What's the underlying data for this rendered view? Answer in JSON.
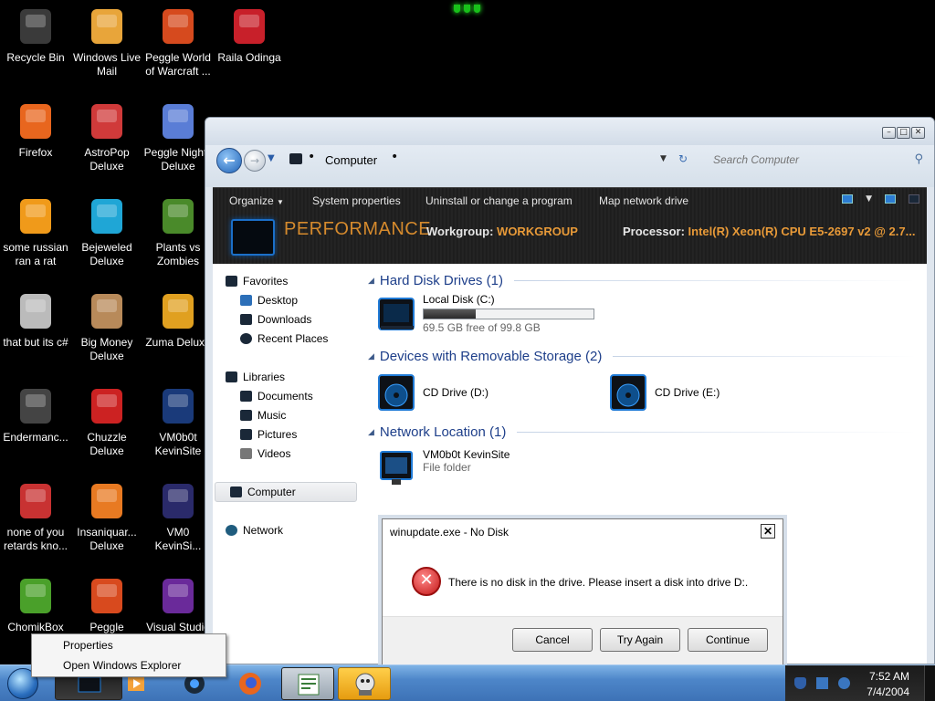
{
  "desktop": {
    "icons": [
      {
        "label": "Recycle Bin",
        "icon": "recycle-bin-icon"
      },
      {
        "label": "Windows Live Mail",
        "icon": "mail-icon"
      },
      {
        "label": "Peggle World of Warcraft ...",
        "icon": "peggle-icon"
      },
      {
        "label": "Raila Odinga",
        "icon": "image-file-icon"
      },
      {
        "label": "Firefox",
        "icon": "firefox-icon"
      },
      {
        "label": "AstroPop Deluxe",
        "icon": "astropop-icon"
      },
      {
        "label": "Peggle Nights Deluxe",
        "icon": "peggle-nights-icon"
      },
      {
        "label": "some russian ran a rat",
        "icon": "java-icon"
      },
      {
        "label": "Bejeweled Deluxe",
        "icon": "bejeweled-icon"
      },
      {
        "label": "Plants vs Zombies",
        "icon": "plants-vs-zombies-icon"
      },
      {
        "label": "that but its c#",
        "icon": "shortcut-icon"
      },
      {
        "label": "Big Money Deluxe",
        "icon": "big-money-icon"
      },
      {
        "label": "Zuma Deluxe",
        "icon": "zuma-icon"
      },
      {
        "label": "Endermanc...",
        "icon": "program-icon"
      },
      {
        "label": "Chuzzle Deluxe",
        "icon": "chuzzle-icon"
      },
      {
        "label": "VM0b0t KevinSite",
        "icon": "folder-monitor-icon"
      },
      {
        "label": "none of you retards kno...",
        "icon": "chrome-icon"
      },
      {
        "label": "Insaniquar... Deluxe",
        "icon": "insaniquarium-icon"
      },
      {
        "label": "VM0 KevinSi...",
        "icon": "file-icon"
      },
      {
        "label": "ChomikBox",
        "icon": "chomikbox-icon"
      },
      {
        "label": "Peggle Deluxe",
        "icon": "peggle-deluxe-icon"
      },
      {
        "label": "Visual Studio",
        "icon": "visual-studio-icon"
      }
    ]
  },
  "explorer": {
    "breadcrumb": "Computer",
    "search_placeholder": "Search Computer",
    "toolbar": {
      "organize": "Organize",
      "system_properties": "System properties",
      "uninstall": "Uninstall or change a program",
      "map_drive": "Map network drive"
    },
    "details": {
      "computer_name": "PERFORMANCE",
      "workgroup_label": "Workgroup:",
      "workgroup_value": "WORKGROUP",
      "processor_label": "Processor:",
      "processor_value": "Intel(R) Xeon(R) CPU E5-2697 v2 @ 2.7..."
    },
    "nav": {
      "favorites": "Favorites",
      "desktop": "Desktop",
      "downloads": "Downloads",
      "recent": "Recent Places",
      "libraries": "Libraries",
      "documents": "Documents",
      "music": "Music",
      "pictures": "Pictures",
      "videos": "Videos",
      "computer": "Computer",
      "network": "Network"
    },
    "groups": {
      "hdd": "Hard Disk Drives (1)",
      "removable": "Devices with Removable Storage (2)",
      "network": "Network Location (1)"
    },
    "drives": {
      "c_name": "Local Disk (C:)",
      "c_free": "69.5 GB free of 99.8 GB",
      "c_used_fraction": 0.304,
      "d_name": "CD Drive (D:)",
      "e_name": "CD Drive (E:)",
      "net_name": "VM0b0t KevinSite",
      "net_type": "File folder"
    }
  },
  "dialog": {
    "title": "winupdate.exe - No Disk",
    "message": "There is no disk in the drive. Please insert a disk into drive D:.",
    "cancel": "Cancel",
    "try_again": "Try Again",
    "continue": "Continue"
  },
  "context_menu": {
    "properties": "Properties",
    "open_explorer": "Open Windows Explorer"
  },
  "taskbar": {
    "time": "7:52 AM",
    "date": "7/4/2004"
  },
  "colors": {
    "accent_orange": "#e89a38",
    "group_blue": "#1e3f8a",
    "taskbar_blue": "#4d86c9",
    "error_red": "#c41616"
  }
}
